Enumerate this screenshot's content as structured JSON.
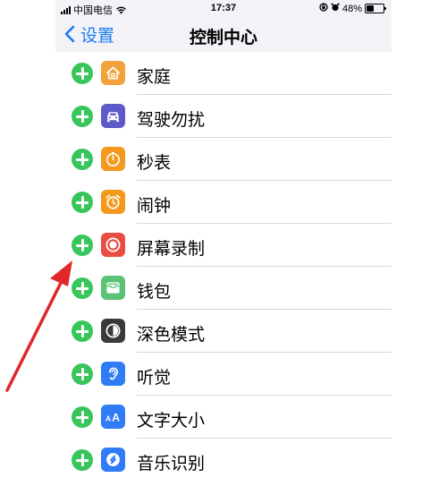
{
  "status_bar": {
    "carrier": "中国电信",
    "time": "17:37",
    "battery": "48%",
    "battery_level": 0.48
  },
  "nav": {
    "back_label": "设置",
    "title": "控制中心"
  },
  "items": [
    {
      "label": "家庭",
      "icon": "home-icon",
      "color": "#f3a23a"
    },
    {
      "label": "驾驶勿扰",
      "icon": "car-icon",
      "color": "#5e5ac8"
    },
    {
      "label": "秒表",
      "icon": "stopwatch-icon",
      "color": "#f39a1e"
    },
    {
      "label": "闹钟",
      "icon": "alarm-clock-icon",
      "color": "#f39a1e"
    },
    {
      "label": "屏幕录制",
      "icon": "screen-record-icon",
      "color": "#e94e45"
    },
    {
      "label": "钱包",
      "icon": "wallet-icon",
      "color": "#5bc276"
    },
    {
      "label": "深色模式",
      "icon": "dark-mode-icon",
      "color": "#3a3a3c"
    },
    {
      "label": "听觉",
      "icon": "ear-icon",
      "color": "#2f7cf6"
    },
    {
      "label": "文字大小",
      "icon": "text-size-icon",
      "color": "#2f7cf6"
    },
    {
      "label": "音乐识别",
      "icon": "shazam-icon",
      "color": "#2f7cf6"
    }
  ],
  "annotation_color": "#e0282a"
}
